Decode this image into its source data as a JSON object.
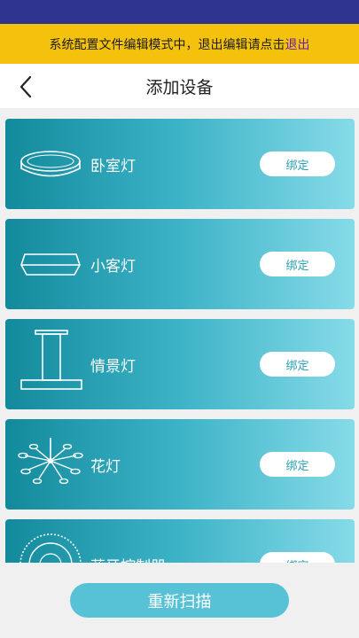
{
  "notice": {
    "text": "系统配置文件编辑模式中，退出编辑请点击",
    "exit_link": "退出"
  },
  "header": {
    "title": "添加设备"
  },
  "devices": [
    {
      "name": "卧室灯",
      "icon": "ceiling-light-icon",
      "action": "绑定"
    },
    {
      "name": "小客灯",
      "icon": "square-ceiling-light-icon",
      "action": "绑定"
    },
    {
      "name": "情景灯",
      "icon": "pendant-light-icon",
      "action": "绑定"
    },
    {
      "name": "花灯",
      "icon": "chandelier-icon",
      "action": "绑定"
    },
    {
      "name": "蓝牙控制器",
      "icon": "bluetooth-controller-icon",
      "action": "绑定"
    }
  ],
  "footer": {
    "rescan_label": "重新扫描"
  },
  "colors": {
    "status_bar": "#2e3390",
    "notice_bg": "#f4c20d",
    "card_start": "#128a9c",
    "card_end": "#86dbe8",
    "button": "#57c2d6"
  }
}
